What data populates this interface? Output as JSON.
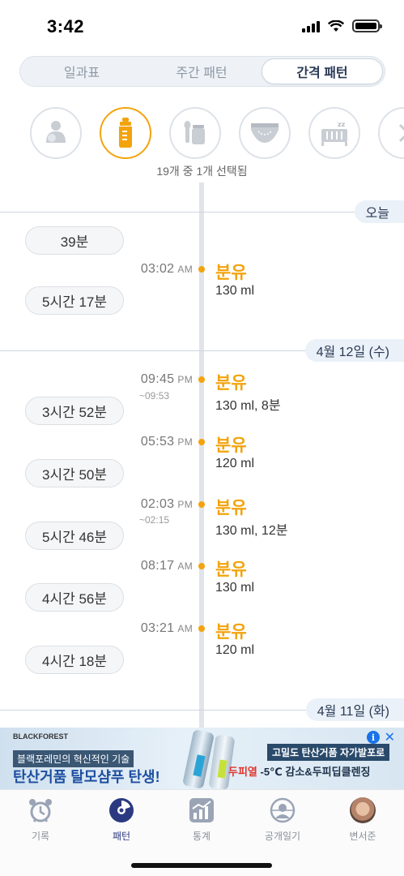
{
  "status_bar": {
    "time": "3:42"
  },
  "segment_tabs": [
    {
      "label": "일과표",
      "active": false
    },
    {
      "label": "주간 패턴",
      "active": false
    },
    {
      "label": "간격 패턴",
      "active": true
    }
  ],
  "categories": [
    {
      "icon": "breastfeeding-icon",
      "active": false
    },
    {
      "icon": "baby-bottle-icon",
      "active": true
    },
    {
      "icon": "baby-food-icon",
      "active": false
    },
    {
      "icon": "diaper-icon",
      "active": false
    },
    {
      "icon": "crib-sleep-icon",
      "active": false
    },
    {
      "icon": "more-chevron-icon",
      "active": false
    }
  ],
  "selected_count": "19개 중 1개 선택됨",
  "dates": {
    "today": "오늘",
    "apr12": "4월 12일 (수)",
    "apr11": "4월 11일 (화)"
  },
  "intervals": [
    "39분",
    "5시간 17분",
    "3시간 52분",
    "3시간 50분",
    "5시간 46분",
    "4시간 56분",
    "4시간 18분"
  ],
  "entries": [
    {
      "time": "03:02",
      "ampm": "AM",
      "end": "",
      "title": "분유",
      "detail": "130 ml"
    },
    {
      "time": "09:45",
      "ampm": "PM",
      "end": "~09:53",
      "title": "분유",
      "detail": "130 ml, 8분"
    },
    {
      "time": "05:53",
      "ampm": "PM",
      "end": "",
      "title": "분유",
      "detail": "120 ml"
    },
    {
      "time": "02:03",
      "ampm": "PM",
      "end": "~02:15",
      "title": "분유",
      "detail": "130 ml, 12분"
    },
    {
      "time": "08:17",
      "ampm": "AM",
      "end": "",
      "title": "분유",
      "detail": "130 ml"
    },
    {
      "time": "03:21",
      "ampm": "AM",
      "end": "",
      "title": "분유",
      "detail": "120 ml"
    }
  ],
  "ad": {
    "brand": "BLACKFOREST",
    "line1": "블랙포레민의 혁신적인 기술",
    "line2": "탄산거품 탈모샴푸 탄생!",
    "right1": "고밀도 탄산거품 자가발포로",
    "right2_red": "두피열",
    "right2_rest": " -5℃ 감소&두피딥클렌징",
    "info": "i",
    "close": "✕"
  },
  "bottom_nav": [
    {
      "label": "기록",
      "icon": "alarm-clock-icon",
      "active": false
    },
    {
      "label": "패턴",
      "icon": "pattern-chart-icon",
      "active": true
    },
    {
      "label": "통계",
      "icon": "stats-icon",
      "active": false
    },
    {
      "label": "공개일기",
      "icon": "public-diary-icon",
      "active": false
    },
    {
      "label": "변서준",
      "icon": "profile-avatar",
      "active": false
    }
  ],
  "colors": {
    "accent": "#f3a30c",
    "navy": "#2b3a55",
    "chip_bg": "#eaf1f8"
  }
}
